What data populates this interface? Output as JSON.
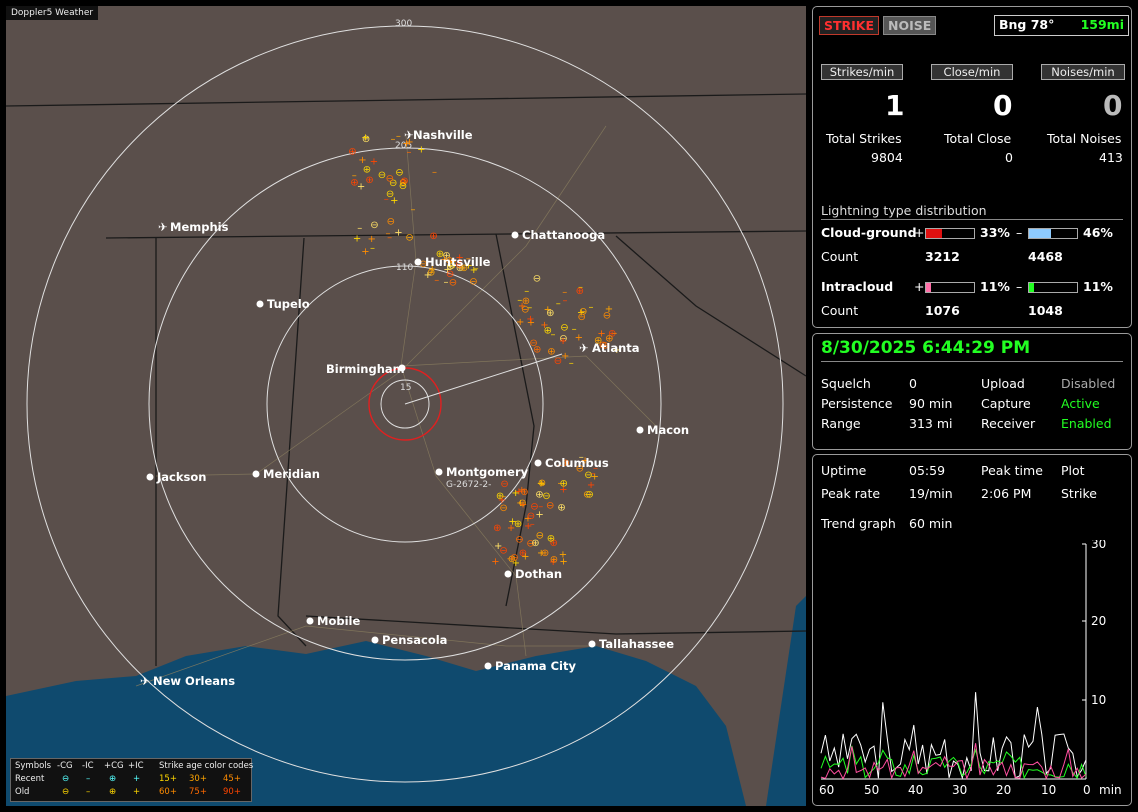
{
  "app_title": "Doppler5 Weather",
  "map": {
    "rings": [
      {
        "label": "15"
      },
      {
        "label": "110"
      },
      {
        "label": "205"
      },
      {
        "label": "300"
      }
    ],
    "cities": [
      {
        "name": "Nashville",
        "airport": true
      },
      {
        "name": "Memphis",
        "airport": true
      },
      {
        "name": "Chattanooga",
        "airport": false
      },
      {
        "name": "Huntsville",
        "airport": false
      },
      {
        "name": "Tupelo",
        "airport": false
      },
      {
        "name": "Atlanta",
        "airport": true
      },
      {
        "name": "Birmingham",
        "airport": false
      },
      {
        "name": "Macon",
        "airport": false
      },
      {
        "name": "Jackson",
        "airport": false
      },
      {
        "name": "Meridian",
        "airport": false
      },
      {
        "name": "Montgomery",
        "airport": false
      },
      {
        "name": "Columbus",
        "airport": false
      },
      {
        "name": "Dothan",
        "airport": false
      },
      {
        "name": "Mobile",
        "airport": false
      },
      {
        "name": "Pensacola",
        "airport": false
      },
      {
        "name": "Tallahassee",
        "airport": false
      },
      {
        "name": "Panama City",
        "airport": false
      },
      {
        "name": "New Orleans",
        "airport": true
      }
    ],
    "track_label": "G-2672-2-",
    "legend": {
      "symbols_label": "Symbols",
      "col_heads": [
        "-CG",
        "-IC",
        "+CG",
        "+IC"
      ],
      "age_title": "Strike age color codes",
      "recent_label": "Recent",
      "old_label": "Old",
      "recent_ages": [
        "15+",
        "30+",
        "45+"
      ],
      "old_ages": [
        "60+",
        "75+",
        "90+"
      ]
    }
  },
  "status": {
    "strike_tab": "STRIKE",
    "noise_tab": "NOISE",
    "bearing_label": "Bng 78°",
    "range_label": "159mi",
    "strikes_min_label": "Strikes/min",
    "close_min_label": "Close/min",
    "noises_min_label": "Noises/min",
    "strikes_min": "1",
    "close_min": "0",
    "noises_min": "0",
    "total_strikes_label": "Total Strikes",
    "total_close_label": "Total Close",
    "total_noises_label": "Total Noises",
    "total_strikes": "9804",
    "total_close": "0",
    "total_noises": "413",
    "dist_title": "Lightning type distribution",
    "cg_label": "Cloud-ground",
    "ic_label": "Intracloud",
    "count_label": "Count",
    "plus": "+",
    "minus": "–",
    "cg_pos_pct": "33%",
    "cg_neg_pct": "46%",
    "cg_pos_count": "3212",
    "cg_neg_count": "4468",
    "ic_pos_pct": "11%",
    "ic_neg_pct": "11%",
    "ic_pos_count": "1076",
    "ic_neg_count": "1048",
    "cg_pos_frac": 0.33,
    "cg_neg_frac": 0.46,
    "ic_pos_frac": 0.11,
    "ic_neg_frac": 0.11
  },
  "settings": {
    "datetime": "8/30/2025 6:44:29 PM",
    "squelch_label": "Squelch",
    "squelch": "0",
    "persistence_label": "Persistence",
    "persistence": "90 min",
    "range_label": "Range",
    "range": "313 mi",
    "upload_label": "Upload",
    "upload": "Disabled",
    "capture_label": "Capture",
    "capture": "Active",
    "receiver_label": "Receiver",
    "receiver": "Enabled"
  },
  "stats": {
    "uptime_label": "Uptime",
    "uptime": "05:59",
    "peak_time_label": "Peak time",
    "peak_time": "2:06 PM",
    "plot_label": "Plot",
    "plot": "Strike",
    "peak_rate_label": "Peak rate",
    "peak_rate": "19/min",
    "trend_label": "Trend graph",
    "trend": "60 min"
  },
  "chart_data": {
    "type": "line",
    "x_ticks": [
      "60",
      "50",
      "40",
      "30",
      "20",
      "10",
      "0"
    ],
    "x_unit": "min",
    "y_ticks": [
      "30",
      "20",
      "10"
    ],
    "ylim": [
      0,
      30
    ]
  }
}
